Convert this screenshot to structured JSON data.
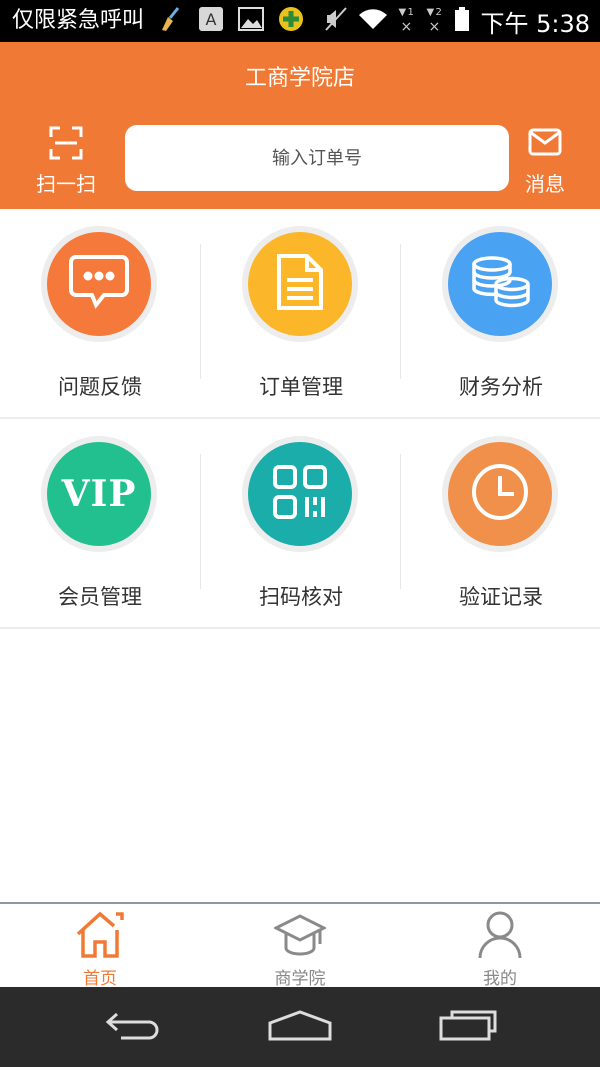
{
  "status_bar": {
    "left_text": "仅限紧急呼叫",
    "sim1": "1",
    "sim2": "2",
    "am_pm": "下午",
    "time": "5:38"
  },
  "header": {
    "title": "工商学院店",
    "scan_label": "扫一扫",
    "search_placeholder": "输入订单号",
    "message_label": "消息",
    "bg_color": "#f07a35"
  },
  "grid": {
    "items": [
      {
        "label": "问题反馈",
        "icon": "chat-bubble-icon",
        "color": "#f5793a"
      },
      {
        "label": "订单管理",
        "icon": "document-icon",
        "color": "#fbb629"
      },
      {
        "label": "财务分析",
        "icon": "coins-stack-icon",
        "color": "#4aa2f3"
      },
      {
        "label": "会员管理",
        "icon": "vip-icon",
        "icon_text": "VIP",
        "color": "#22c08e"
      },
      {
        "label": "扫码核对",
        "icon": "qr-code-icon",
        "color": "#1aada9"
      },
      {
        "label": "验证记录",
        "icon": "clock-icon",
        "color": "#f0904a"
      }
    ]
  },
  "tab_bar": {
    "tabs": [
      {
        "label": "首页",
        "icon": "home-icon",
        "active": true
      },
      {
        "label": "商学院",
        "icon": "graduation-cap-icon",
        "active": false
      },
      {
        "label": "我的",
        "icon": "user-icon",
        "active": false
      }
    ],
    "active_color": "#f07a35"
  },
  "nav_bar": {
    "buttons": [
      "back-icon",
      "home-outline-icon",
      "recents-icon"
    ]
  }
}
